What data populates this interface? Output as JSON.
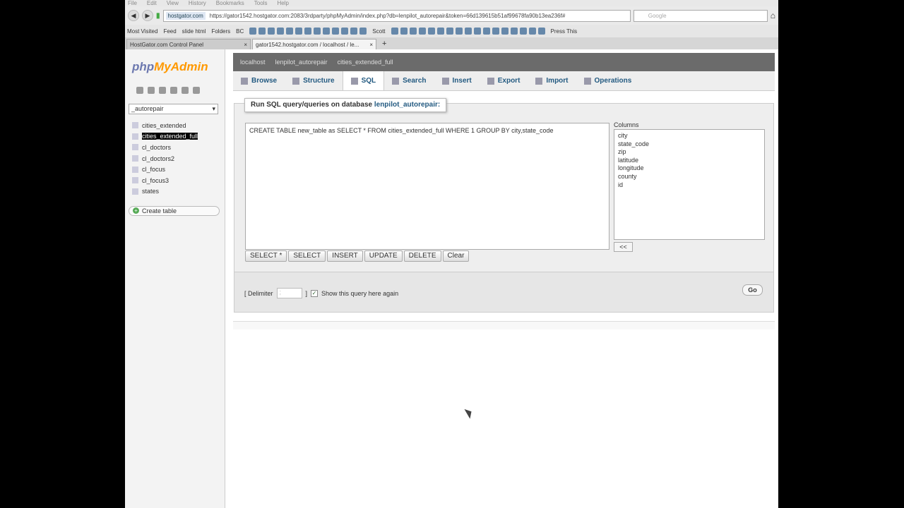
{
  "browser": {
    "menu": [
      "File",
      "Edit",
      "View",
      "History",
      "Bookmarks",
      "Tools",
      "Help"
    ],
    "url_site": "hostgator.com",
    "url": "https://gator1542.hostgator.com:2083/3rdparty/phpMyAdmin/index.php?db=lenpilot_autorepair&token=66d139615b51af99678fa90b13ea236f#",
    "search_placeholder": "Google",
    "bookmarks": {
      "most_visited": "Most Visited",
      "feed": "Feed",
      "slide": "slide html",
      "folders": "Folders",
      "bc": "BC",
      "scott": "Scott",
      "press": "Press This"
    },
    "tabs": [
      {
        "label": "HostGator.com Control Panel"
      },
      {
        "label": "gator1542.hostgator.com / localhost / le..."
      }
    ]
  },
  "sidebar": {
    "logo_a": "php",
    "logo_b": "MyAdmin",
    "db_select": "_autorepair",
    "tables": [
      "cities_extended",
      "cities_extended_full",
      "cl_doctors",
      "cl_doctors2",
      "cl_focus",
      "cl_focus3",
      "states"
    ],
    "selected": "cities_extended_full",
    "create": "Create table"
  },
  "breadcrumb": [
    "localhost",
    "lenpilot_autorepair",
    "cities_extended_full"
  ],
  "tabs": [
    "Browse",
    "Structure",
    "SQL",
    "Search",
    "Insert",
    "Export",
    "Import",
    "Operations"
  ],
  "active_tab": "SQL",
  "sql": {
    "legend": "Run SQL query/queries on database ",
    "db": "lenpilot_autorepair:",
    "query": "CREATE TABLE new_table as SELECT * FROM cities_extended_full WHERE 1 GROUP BY city,state_code",
    "columns_label": "Columns",
    "columns": [
      "city",
      "state_code",
      "zip",
      "latitude",
      "longitude",
      "county",
      "id"
    ],
    "insert_btn": "<<",
    "buttons": [
      "SELECT *",
      "SELECT",
      "INSERT",
      "UPDATE",
      "DELETE",
      "Clear"
    ],
    "delimiter_label": "[ Delimiter",
    "delimiter_value": ";",
    "bracket": "]",
    "show_again": "Show this query here again",
    "go": "Go"
  }
}
